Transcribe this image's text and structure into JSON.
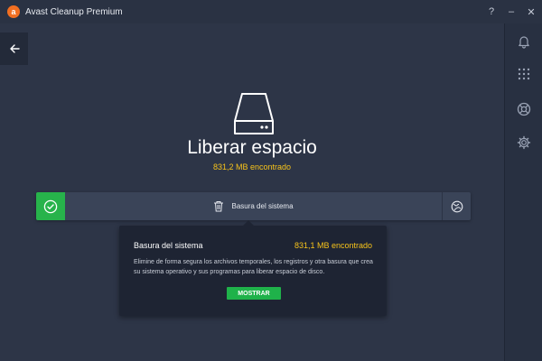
{
  "window": {
    "title": "Avast Cleanup Premium",
    "logo_letter": "a",
    "controls": {
      "help": "?",
      "minimize": "–",
      "close": "✕"
    }
  },
  "icons": {
    "back": "arrow-left-icon",
    "notifications": "bell-icon",
    "apps": "grid-icon",
    "help": "lifebuoy-icon",
    "settings": "gear-icon",
    "hero": "hard-drive-icon",
    "check": "check-icon",
    "trash": "trash-icon",
    "globe": "globe-icon"
  },
  "main": {
    "title": "Liberar espacio",
    "found": "831,2 MB encontrado"
  },
  "result_bar": {
    "label": "Basura del sistema"
  },
  "popup": {
    "title": "Basura del sistema",
    "found": "831,1 MB encontrado",
    "description": "Elimine de forma segura los archivos temporales, los registros y otra basura que crea su sistema operativo y sus programas para liberar espacio de disco.",
    "button": "MOSTRAR"
  },
  "colors": {
    "background": "#2d3547",
    "accent_yellow": "#f7c31a",
    "accent_green": "#1fb24a",
    "brand_orange": "#f26f21",
    "popup_bg": "#1e2433"
  }
}
